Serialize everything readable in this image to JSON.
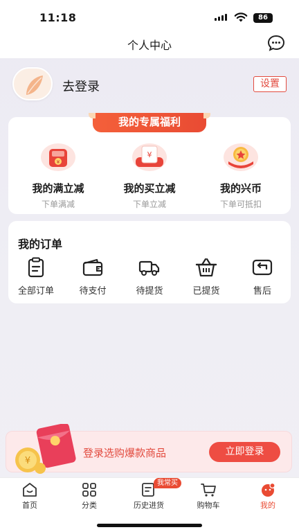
{
  "status": {
    "time": "11:18",
    "battery": "86"
  },
  "header": {
    "title": "个人中心"
  },
  "profile": {
    "login_text": "去登录",
    "settings_label": "设置"
  },
  "welfare": {
    "tag": "我的专属福利",
    "items": [
      {
        "title": "我的满立减",
        "subtitle": "下单满减",
        "icon": "full-discount-icon"
      },
      {
        "title": "我的买立减",
        "subtitle": "下单立减",
        "icon": "instant-discount-icon"
      },
      {
        "title": "我的兴币",
        "subtitle": "下单可抵扣",
        "icon": "coin-icon"
      }
    ]
  },
  "orders": {
    "title": "我的订单",
    "items": [
      {
        "label": "全部订单",
        "icon": "clipboard-icon"
      },
      {
        "label": "待支付",
        "icon": "wallet-icon"
      },
      {
        "label": "待提货",
        "icon": "truck-icon"
      },
      {
        "label": "已提货",
        "icon": "basket-icon"
      },
      {
        "label": "售后",
        "icon": "return-icon"
      }
    ]
  },
  "banner": {
    "text": "登录选购爆款商品",
    "button": "立即登录"
  },
  "tabbar": {
    "badge": "我常买",
    "items": [
      {
        "label": "首页",
        "icon": "home-icon"
      },
      {
        "label": "分类",
        "icon": "category-icon"
      },
      {
        "label": "历史进货",
        "icon": "history-icon"
      },
      {
        "label": "购物车",
        "icon": "cart-icon"
      },
      {
        "label": "我的",
        "icon": "profile-icon",
        "active": true
      }
    ]
  },
  "colors": {
    "accent": "#e94b33",
    "accent_light": "#fde9ea",
    "muted": "#999999"
  }
}
